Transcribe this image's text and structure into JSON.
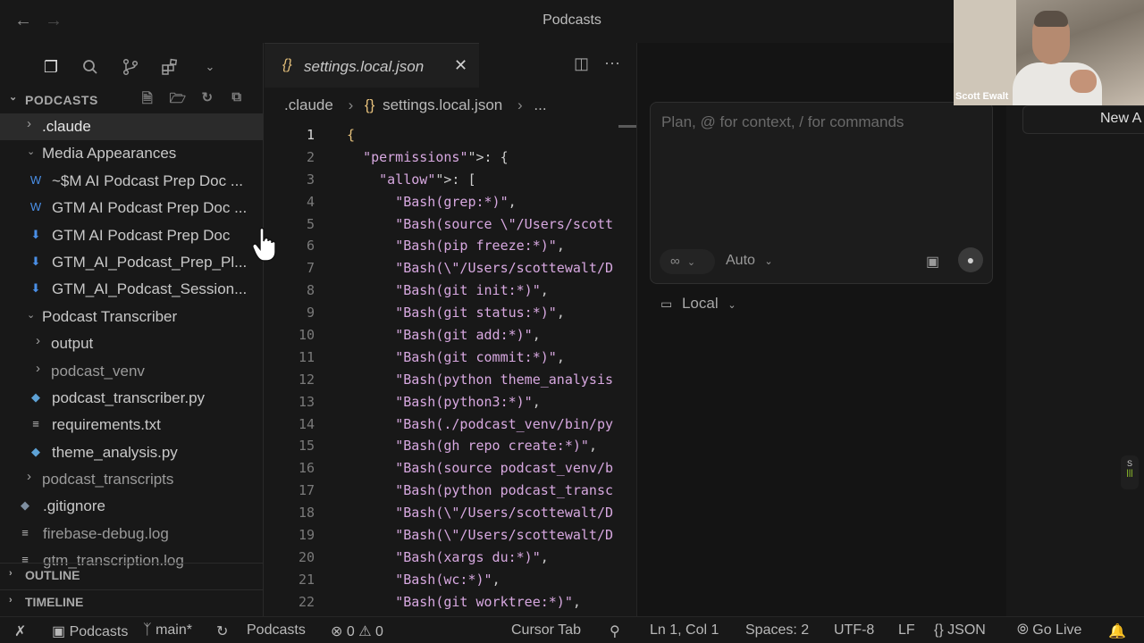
{
  "titlebar": {
    "title": "Podcasts",
    "back_icon": "arrow-left-icon",
    "forward_icon": "arrow-right-icon"
  },
  "sidebar": {
    "header": "PODCASTS",
    "tree": [
      {
        "label": ".claude",
        "kind": "folder",
        "expanded": false,
        "depth": 1,
        "selected": true
      },
      {
        "label": "Media Appearances",
        "kind": "folder",
        "expanded": true,
        "depth": 1
      },
      {
        "label": "~$M AI Podcast Prep Doc ...",
        "kind": "word",
        "depth": 2
      },
      {
        "label": "GTM AI Podcast Prep Doc ...",
        "kind": "word",
        "depth": 2
      },
      {
        "label": "GTM AI Podcast Prep Doc",
        "kind": "download",
        "depth": 2
      },
      {
        "label": "GTM_AI_Podcast_Prep_Pl...",
        "kind": "download",
        "depth": 2
      },
      {
        "label": "GTM_AI_Podcast_Session...",
        "kind": "download",
        "depth": 2
      },
      {
        "label": "Podcast Transcriber",
        "kind": "folder",
        "expanded": true,
        "depth": 1
      },
      {
        "label": "output",
        "kind": "folder",
        "expanded": false,
        "depth": 2
      },
      {
        "label": "podcast_venv",
        "kind": "folder",
        "expanded": false,
        "depth": 2,
        "dim": true
      },
      {
        "label": "podcast_transcriber.py",
        "kind": "python",
        "depth": 2
      },
      {
        "label": "requirements.txt",
        "kind": "text",
        "depth": 2
      },
      {
        "label": "theme_analysis.py",
        "kind": "python",
        "depth": 2
      },
      {
        "label": "podcast_transcripts",
        "kind": "folder",
        "expanded": false,
        "depth": 1,
        "dim": true
      },
      {
        "label": ".gitignore",
        "kind": "git",
        "depth": 1
      },
      {
        "label": "firebase-debug.log",
        "kind": "text",
        "depth": 1,
        "dim": true
      },
      {
        "label": "gtm_transcription.log",
        "kind": "text",
        "depth": 1,
        "dim": true
      }
    ],
    "outline": "OUTLINE",
    "timeline": "TIMELINE"
  },
  "editor": {
    "tab": {
      "icon": "{}",
      "label": "settings.local.json"
    },
    "breadcrumb": [
      ".claude",
      "settings.local.json",
      "..."
    ],
    "breadcrumb_icon": "{}",
    "lines": [
      {
        "n": "1",
        "t": "{"
      },
      {
        "n": "2",
        "t": "  \"permissions\": {"
      },
      {
        "n": "3",
        "t": "    \"allow\": ["
      },
      {
        "n": "4",
        "t": "      \"Bash(grep:*)\","
      },
      {
        "n": "5",
        "t": "      \"Bash(source \\\"/Users/scott"
      },
      {
        "n": "6",
        "t": "      \"Bash(pip freeze:*)\","
      },
      {
        "n": "7",
        "t": "      \"Bash(\\\"/Users/scottewalt/D"
      },
      {
        "n": "8",
        "t": "      \"Bash(git init:*)\","
      },
      {
        "n": "9",
        "t": "      \"Bash(git status:*)\","
      },
      {
        "n": "10",
        "t": "      \"Bash(git add:*)\","
      },
      {
        "n": "11",
        "t": "      \"Bash(git commit:*)\","
      },
      {
        "n": "12",
        "t": "      \"Bash(python theme_analysis"
      },
      {
        "n": "13",
        "t": "      \"Bash(python3:*)\","
      },
      {
        "n": "14",
        "t": "      \"Bash(./podcast_venv/bin/py"
      },
      {
        "n": "15",
        "t": "      \"Bash(gh repo create:*)\","
      },
      {
        "n": "16",
        "t": "      \"Bash(source podcast_venv/b"
      },
      {
        "n": "17",
        "t": "      \"Bash(python podcast_transc"
      },
      {
        "n": "18",
        "t": "      \"Bash(\\\"/Users/scottewalt/D"
      },
      {
        "n": "19",
        "t": "      \"Bash(\\\"/Users/scottewalt/D"
      },
      {
        "n": "20",
        "t": "      \"Bash(xargs du:*)\","
      },
      {
        "n": "21",
        "t": "      \"Bash(wc:*)\","
      },
      {
        "n": "22",
        "t": "      \"Bash(git worktree:*)\","
      }
    ]
  },
  "chat": {
    "placeholder": "Plan, @ for context, / for commands",
    "mode": "∞",
    "model": "Auto",
    "location": "Local",
    "new_agent_label": "New A"
  },
  "webcam": {
    "name": "Scott Ewalt"
  },
  "statusbar": {
    "workspace": "Podcasts",
    "branch": "main*",
    "project": "Podcasts",
    "errors": "0",
    "warnings": "0",
    "cursor_tab": "Cursor Tab",
    "position": "Ln 1, Col 1",
    "spaces": "Spaces: 2",
    "encoding": "UTF-8",
    "eol": "LF",
    "language": "JSON",
    "go_live": "Go Live"
  }
}
